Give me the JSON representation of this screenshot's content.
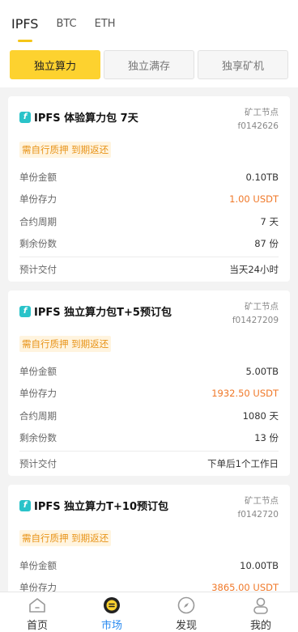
{
  "top_tabs": [
    {
      "label": "IPFS"
    },
    {
      "label": "BTC"
    },
    {
      "label": "ETH"
    }
  ],
  "segments": [
    {
      "label": "独立算力"
    },
    {
      "label": "独立满存"
    },
    {
      "label": "独享矿机"
    }
  ],
  "cards": [
    {
      "icon": "f",
      "title": "IPFS 体验算力包 7天",
      "node_label": "矿工节点",
      "node_id": "f0142626",
      "badge": "需自行质押 到期返还",
      "rows": [
        {
          "k": "单份金额",
          "v": "0.10TB"
        },
        {
          "k": "单份存力",
          "v": "1.00 USDT"
        },
        {
          "k": "合约周期",
          "v": "7 天"
        },
        {
          "k": "剩余份数",
          "v": "87 份"
        }
      ],
      "foot": {
        "k": "预计交付",
        "v": "当天24小时"
      }
    },
    {
      "icon": "f",
      "title": "IPFS 独立算力包T+5预订包",
      "node_label": "矿工节点",
      "node_id": "f01427209",
      "badge": "需自行质押 到期返还",
      "rows": [
        {
          "k": "单份金额",
          "v": "5.00TB"
        },
        {
          "k": "单份存力",
          "v": "1932.50 USDT"
        },
        {
          "k": "合约周期",
          "v": "1080 天"
        },
        {
          "k": "剩余份数",
          "v": "13 份"
        }
      ],
      "foot": {
        "k": "预计交付",
        "v": "下单后1个工作日"
      }
    },
    {
      "icon": "f",
      "title": "IPFS 独立算力T+10预订包",
      "node_label": "矿工节点",
      "node_id": "f0142720",
      "badge": "需自行质押 到期返还",
      "rows": [
        {
          "k": "单份金额",
          "v": "10.00TB"
        },
        {
          "k": "单份存力",
          "v": "3865.00 USDT"
        }
      ]
    }
  ],
  "bottom_nav": [
    {
      "label": "首页",
      "icon": "home-icon"
    },
    {
      "label": "市场",
      "icon": "market-coin-icon"
    },
    {
      "label": "发现",
      "icon": "compass-icon"
    },
    {
      "label": "我的",
      "icon": "user-icon"
    }
  ],
  "colors": {
    "accent_yellow": "#fdd22f",
    "price_orange": "#f07828",
    "badge_orange": "#e8941a",
    "nav_active_blue": "#2d8cf0",
    "icon_teal": "#2ac3c9"
  }
}
